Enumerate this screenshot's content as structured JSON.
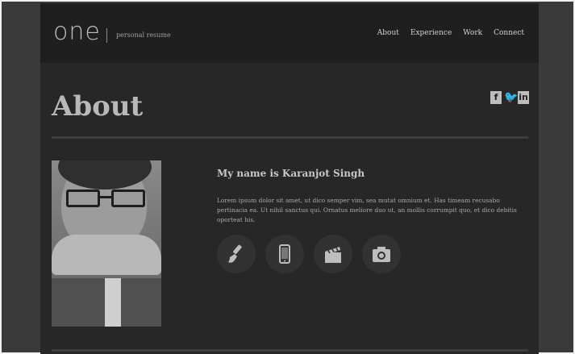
{
  "header": {
    "logo": "one",
    "tagline": "personal resume",
    "nav": [
      "About",
      "Experience",
      "Work",
      "Connect"
    ]
  },
  "section": {
    "title": "About",
    "social": [
      "facebook-icon",
      "twitter-icon",
      "linkedin-icon"
    ]
  },
  "profile": {
    "name": "My name is Karanjot Singh",
    "bio": "Lorem ipsum dolor sit amet, ut dico semper vim, sea mutat omnium et. Has timeam recusabo pertinacia ea. Ut nihil sanctus qui. Ornatus meliore duo ut, an mollis corrumpit quo, et dico debitis oporteat his.",
    "skills": [
      "paintbrush-icon",
      "smartphone-icon",
      "clapperboard-icon",
      "camera-icon"
    ]
  }
}
